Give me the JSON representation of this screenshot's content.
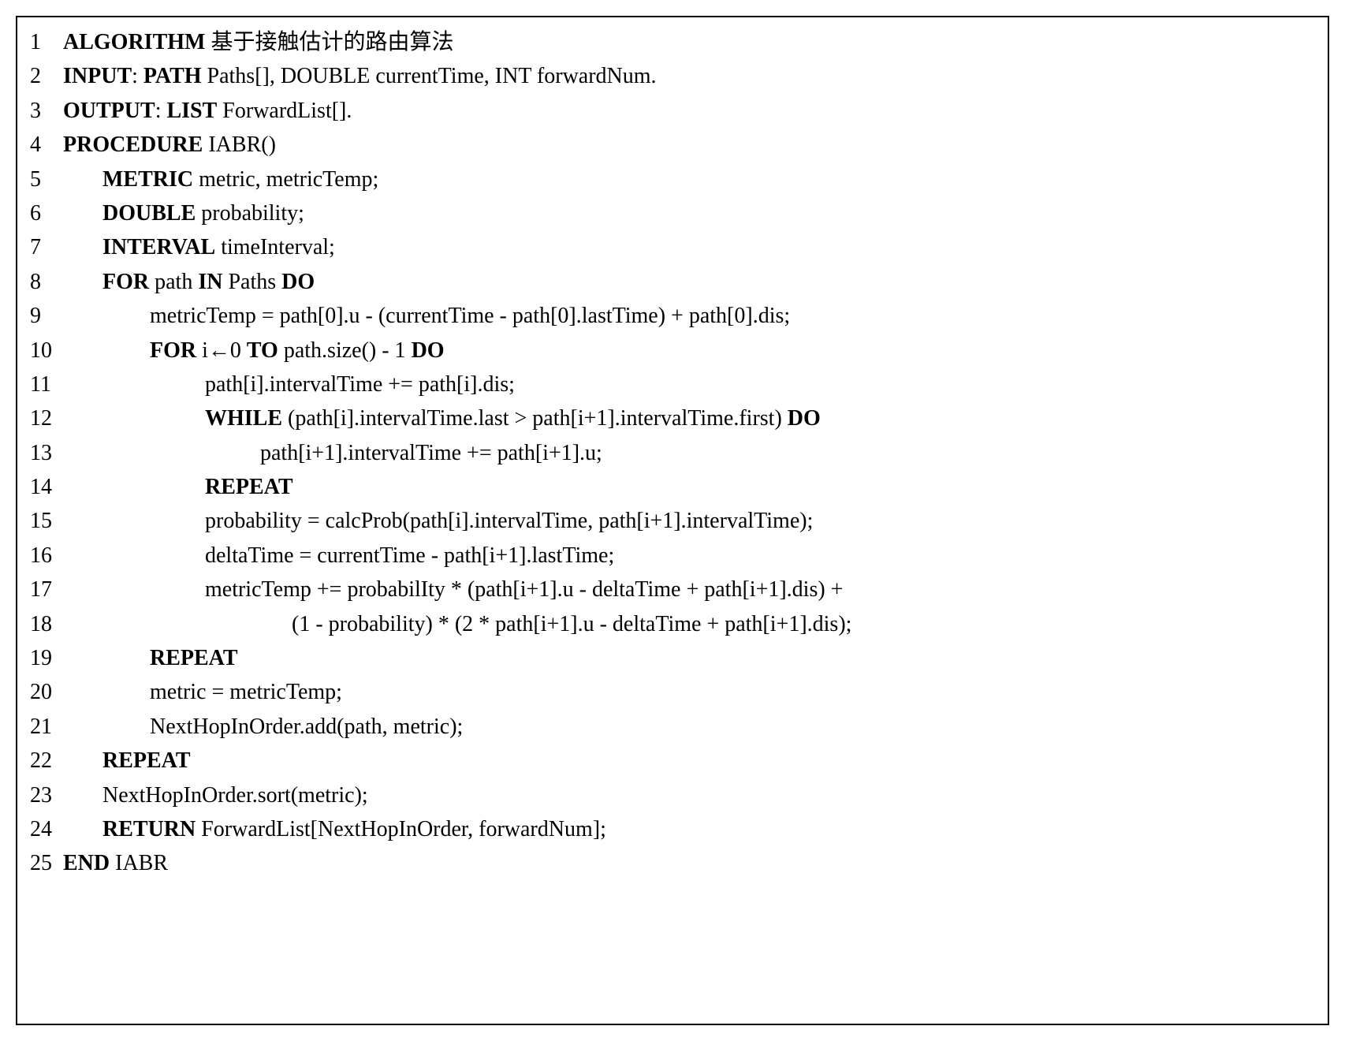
{
  "algorithm": {
    "lines": [
      {
        "num": "1",
        "indent": 0,
        "segments": [
          {
            "bold": true,
            "text": "ALGORITHM"
          },
          {
            "bold": false,
            "text": "  基于接触估计的路由算法"
          }
        ]
      },
      {
        "num": "2",
        "indent": 0,
        "segments": [
          {
            "bold": true,
            "text": "INPUT"
          },
          {
            "bold": false,
            "text": ": "
          },
          {
            "bold": true,
            "text": "PATH"
          },
          {
            "bold": false,
            "text": " Paths[], DOUBLE currentTime, INT forwardNum."
          }
        ]
      },
      {
        "num": "3",
        "indent": 0,
        "segments": [
          {
            "bold": true,
            "text": "OUTPUT"
          },
          {
            "bold": false,
            "text": ": "
          },
          {
            "bold": true,
            "text": "LIST"
          },
          {
            "bold": false,
            "text": " ForwardList[]."
          }
        ]
      },
      {
        "num": "4",
        "indent": 0,
        "segments": [
          {
            "bold": true,
            "text": "PROCEDURE"
          },
          {
            "bold": false,
            "text": " IABR()"
          }
        ]
      },
      {
        "num": "5",
        "indent": 1,
        "segments": [
          {
            "bold": true,
            "text": "METRIC"
          },
          {
            "bold": false,
            "text": " metric, metricTemp;"
          }
        ]
      },
      {
        "num": "6",
        "indent": 1,
        "segments": [
          {
            "bold": true,
            "text": "DOUBLE"
          },
          {
            "bold": false,
            "text": " probability;"
          }
        ]
      },
      {
        "num": "7",
        "indent": 1,
        "segments": [
          {
            "bold": true,
            "text": "INTERVAL"
          },
          {
            "bold": false,
            "text": " timeInterval;"
          }
        ]
      },
      {
        "num": "8",
        "indent": 1,
        "segments": [
          {
            "bold": true,
            "text": "FOR"
          },
          {
            "bold": false,
            "text": " path "
          },
          {
            "bold": true,
            "text": "IN"
          },
          {
            "bold": false,
            "text": " Paths "
          },
          {
            "bold": true,
            "text": "DO"
          }
        ]
      },
      {
        "num": "9",
        "indent": 2,
        "segments": [
          {
            "bold": false,
            "text": "metricTemp = path[0].u - (currentTime - path[0].lastTime) + path[0].dis;"
          }
        ]
      },
      {
        "num": "10",
        "indent": 2,
        "segments": [
          {
            "bold": true,
            "text": "FOR"
          },
          {
            "bold": false,
            "text": "  i←0 "
          },
          {
            "bold": true,
            "text": "TO"
          },
          {
            "bold": false,
            "text": " path.size() - 1 "
          },
          {
            "bold": true,
            "text": "DO"
          }
        ]
      },
      {
        "num": "11",
        "indent": 3,
        "segments": [
          {
            "bold": false,
            "text": "path[i].intervalTime += path[i].dis;"
          }
        ]
      },
      {
        "num": "12",
        "indent": 3,
        "segments": [
          {
            "bold": true,
            "text": "WHILE"
          },
          {
            "bold": false,
            "text": " (path[i].intervalTime.last > path[i+1].intervalTime.first) "
          },
          {
            "bold": true,
            "text": "DO"
          }
        ]
      },
      {
        "num": "13",
        "indent": 4,
        "segments": [
          {
            "bold": false,
            "text": "path[i+1].intervalTime += path[i+1].u;"
          }
        ]
      },
      {
        "num": "14",
        "indent": 3,
        "segments": [
          {
            "bold": true,
            "text": "REPEAT"
          }
        ]
      },
      {
        "num": "15",
        "indent": 3,
        "segments": [
          {
            "bold": false,
            "text": "probability = calcProb(path[i].intervalTime, path[i+1].intervalTime);"
          }
        ]
      },
      {
        "num": "16",
        "indent": 3,
        "segments": [
          {
            "bold": false,
            "text": "deltaTime = currentTime - path[i+1].lastTime;"
          }
        ]
      },
      {
        "num": "17",
        "indent": 3,
        "segments": [
          {
            "bold": false,
            "text": "metricTemp += probabilIty * (path[i+1].u - deltaTime + path[i+1].dis) +"
          }
        ]
      },
      {
        "num": "18",
        "indent": 5,
        "segments": [
          {
            "bold": false,
            "text": "(1 - probability) * (2 * path[i+1].u - deltaTime + path[i+1].dis);"
          }
        ]
      },
      {
        "num": "19",
        "indent": 2,
        "segments": [
          {
            "bold": true,
            "text": "REPEAT"
          }
        ]
      },
      {
        "num": "20",
        "indent": 2,
        "segments": [
          {
            "bold": false,
            "text": "metric = metricTemp;"
          }
        ]
      },
      {
        "num": "21",
        "indent": 2,
        "segments": [
          {
            "bold": false,
            "text": "NextHopInOrder.add(path, metric);"
          }
        ]
      },
      {
        "num": "22",
        "indent": 1,
        "segments": [
          {
            "bold": true,
            "text": "REPEAT"
          }
        ]
      },
      {
        "num": "23",
        "indent": 1,
        "segments": [
          {
            "bold": false,
            "text": "NextHopInOrder.sort(metric);"
          }
        ]
      },
      {
        "num": "24",
        "indent": 1,
        "segments": [
          {
            "bold": true,
            "text": "RETURN"
          },
          {
            "bold": false,
            "text": " ForwardList[NextHopInOrder, forwardNum];"
          }
        ]
      },
      {
        "num": "25",
        "indent": 0,
        "segments": [
          {
            "bold": true,
            "text": "END"
          },
          {
            "bold": false,
            "text": " IABR"
          }
        ]
      }
    ]
  }
}
